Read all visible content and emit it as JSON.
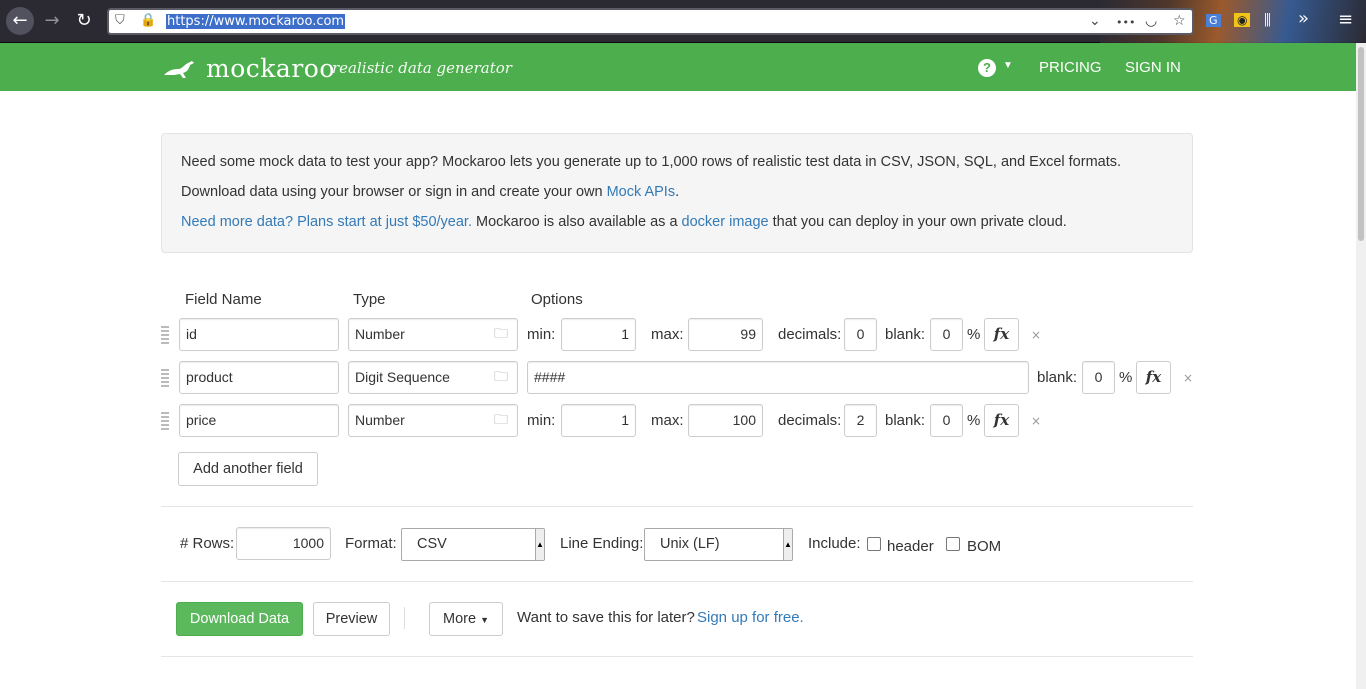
{
  "browser": {
    "url": "https://www.mockaroo.com",
    "icons": [
      "back-icon",
      "forward-icon",
      "reload-icon",
      "shield-icon",
      "lock-icon",
      "dropdown-icon",
      "more-icon",
      "pocket-icon",
      "star-icon",
      "translate-icon",
      "extension-icon",
      "library-icon",
      "overflow-icon",
      "menu-icon"
    ],
    "glyphs": {
      "back": "←",
      "forward": "→",
      "reload": "↻",
      "shield": "⛉",
      "lock": "🔒",
      "dropdown": "⌄",
      "more": "•••",
      "pocket": "◡",
      "star": "☆",
      "library": "⫼",
      "overflow": "»",
      "menu": "≡",
      "translate": "G",
      "ext": "◉"
    }
  },
  "header": {
    "logo_name": "mockaroo",
    "tagline": "realistic data generator",
    "help": "?",
    "pricing": "PRICING",
    "signin": "SIGN IN"
  },
  "intro": {
    "line1": "Need some mock data to test your app? Mockaroo lets you generate up to 1,000 rows of realistic test data in CSV, JSON, SQL, and Excel formats.",
    "line2_pre": "Download data using your browser or sign in and create your own ",
    "line2_link": "Mock APIs",
    "line2_post": ".",
    "line3_link1": "Need more data? Plans start at just $50/year.",
    "line3_mid": " Mockaroo is also available as a ",
    "line3_link2": "docker image",
    "line3_post": " that you can deploy in your own private cloud."
  },
  "schema": {
    "col_field": "Field Name",
    "col_type": "Type",
    "col_options": "Options",
    "fields": [
      {
        "name": "id",
        "type": "Number",
        "min_label": "min:",
        "min": "1",
        "max_label": "max:",
        "max": "99",
        "dec_label": "decimals:",
        "decimals": "0",
        "blank_label": "blank:",
        "blank": "0",
        "pct": "%",
        "fx": "fx",
        "remove": "×"
      },
      {
        "name": "product",
        "type": "Digit Sequence",
        "format": "####",
        "blank_label": "blank:",
        "blank": "0",
        "pct": "%",
        "fx": "fx",
        "remove": "×"
      },
      {
        "name": "price",
        "type": "Number",
        "min_label": "min:",
        "min": "1",
        "max_label": "max:",
        "max": "100",
        "dec_label": "decimals:",
        "decimals": "2",
        "blank_label": "blank:",
        "blank": "0",
        "pct": "%",
        "fx": "fx",
        "remove": "×"
      }
    ],
    "add_field": "Add another field"
  },
  "settings": {
    "rows_label": "# Rows:",
    "rows": "1000",
    "format_label": "Format:",
    "format": "CSV",
    "line_ending_label": "Line Ending:",
    "line_ending": "Unix (LF)",
    "include_label": "Include:",
    "header_label": "header",
    "bom_label": "BOM"
  },
  "actions": {
    "download": "Download Data",
    "preview": "Preview",
    "more": "More",
    "save_text": "Want to save this for later?",
    "signup": "Sign up for free."
  }
}
